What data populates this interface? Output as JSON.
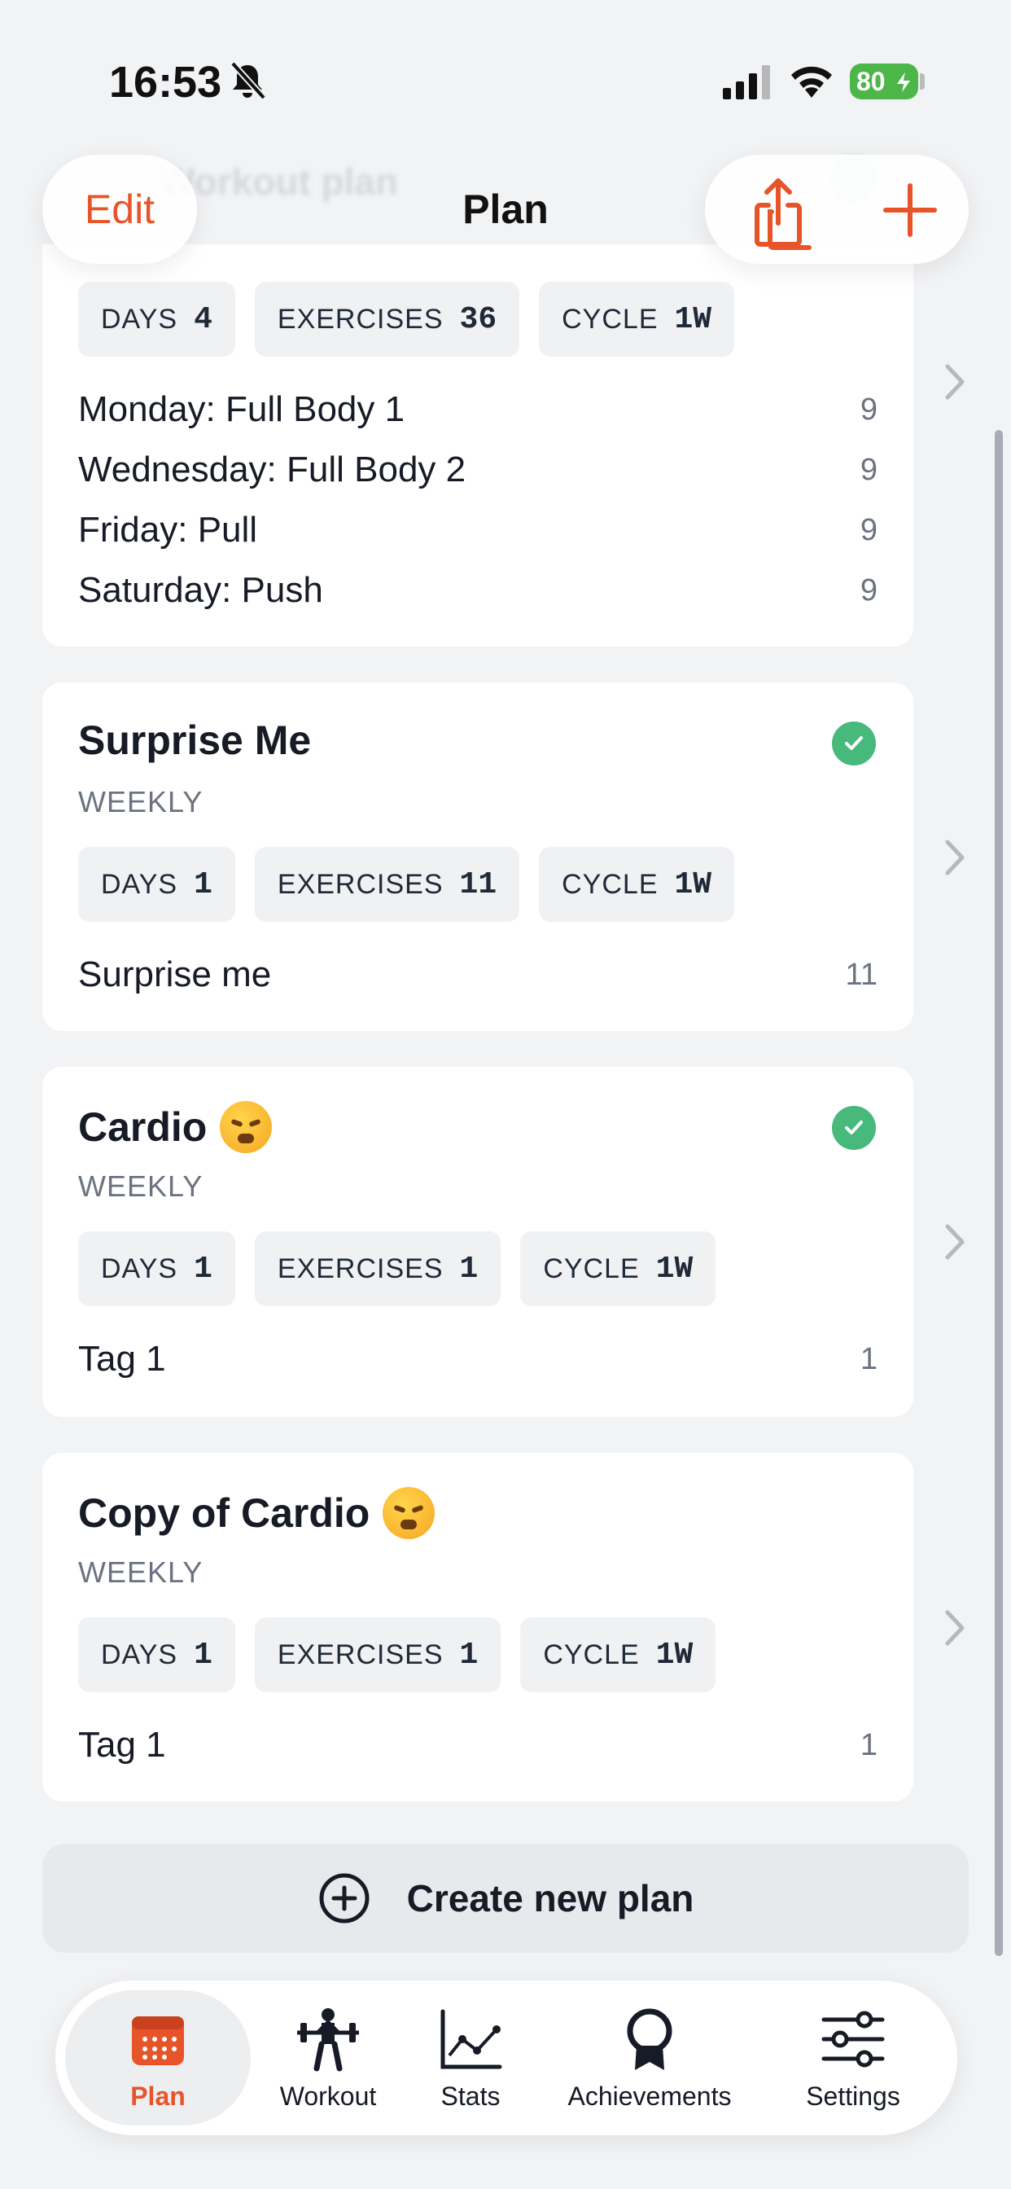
{
  "status_bar": {
    "time": "16:53",
    "battery": "80"
  },
  "nav": {
    "title": "Plan",
    "edit_label": "Edit",
    "ghost_title": "Workout plan"
  },
  "plans": [
    {
      "title": "",
      "chips": [
        {
          "label": "DAYS",
          "value": "4"
        },
        {
          "label": "EXERCISES",
          "value": "36"
        },
        {
          "label": "CYCLE",
          "value": "1W"
        }
      ],
      "days": [
        {
          "name": "Monday: Full Body 1",
          "count": "9"
        },
        {
          "name": "Wednesday: Full Body 2",
          "count": "9"
        },
        {
          "name": "Friday: Pull",
          "count": "9"
        },
        {
          "name": "Saturday: Push",
          "count": "9"
        }
      ]
    },
    {
      "title": "Surprise Me",
      "subtitle": "WEEKLY",
      "active": true,
      "chips": [
        {
          "label": "DAYS",
          "value": "1"
        },
        {
          "label": "EXERCISES",
          "value": "11"
        },
        {
          "label": "CYCLE",
          "value": "1W"
        }
      ],
      "days": [
        {
          "name": "Surprise me",
          "count": "11"
        }
      ]
    },
    {
      "title": "Cardio",
      "subtitle": "WEEKLY",
      "emoji": "face-with-steam-emoji",
      "active": true,
      "chips": [
        {
          "label": "DAYS",
          "value": "1"
        },
        {
          "label": "EXERCISES",
          "value": "1"
        },
        {
          "label": "CYCLE",
          "value": "1W"
        }
      ],
      "days": [
        {
          "name": "Tag 1",
          "count": "1"
        }
      ]
    },
    {
      "title": "Copy of Cardio",
      "subtitle": "WEEKLY",
      "emoji": "face-with-steam-emoji",
      "chips": [
        {
          "label": "DAYS",
          "value": "1"
        },
        {
          "label": "EXERCISES",
          "value": "1"
        },
        {
          "label": "CYCLE",
          "value": "1W"
        }
      ],
      "days": [
        {
          "name": "Tag 1",
          "count": "1"
        }
      ]
    }
  ],
  "create_plan_label": "Create new plan",
  "tabs": [
    {
      "label": "Plan",
      "icon": "calendar-icon",
      "active": true
    },
    {
      "label": "Workout",
      "icon": "weightlifter-icon"
    },
    {
      "label": "Stats",
      "icon": "chart-icon"
    },
    {
      "label": "Achievements",
      "icon": "award-icon"
    },
    {
      "label": "Settings",
      "icon": "sliders-icon"
    }
  ],
  "colors": {
    "accent": "#e8542a",
    "success": "#47b97a",
    "background": "#f2f3f5"
  }
}
